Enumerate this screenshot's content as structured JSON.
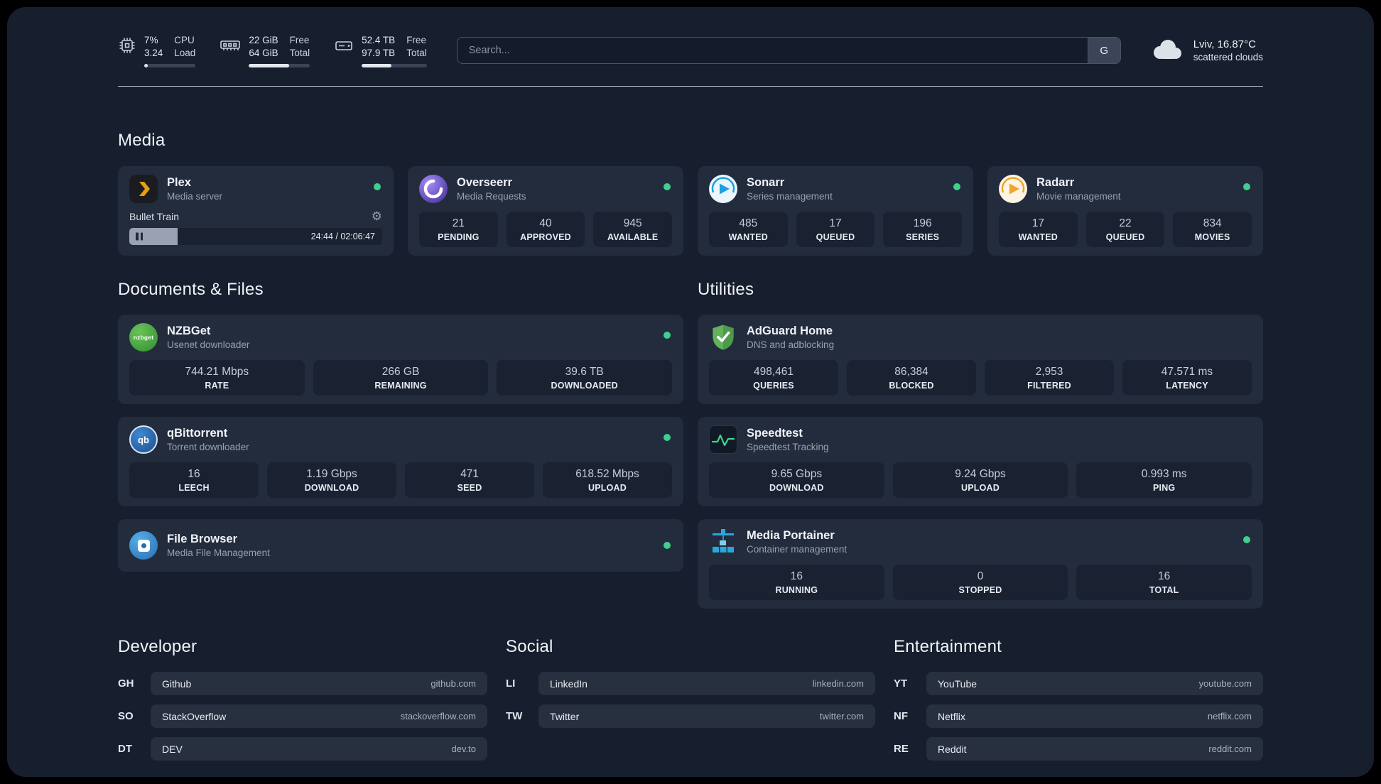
{
  "header": {
    "cpu": {
      "value1": "7%",
      "value2": "3.24",
      "label1": "CPU",
      "label2": "Load",
      "bar_percent": 7
    },
    "memory": {
      "value1": "22 GiB",
      "value2": "64 GiB",
      "label1": "Free",
      "label2": "Total",
      "bar_percent": 66
    },
    "disk": {
      "value1": "52.4 TB",
      "value2": "97.9 TB",
      "label1": "Free",
      "label2": "Total",
      "bar_percent": 46
    },
    "search": {
      "placeholder": "Search...",
      "engine_button": "G"
    },
    "weather": {
      "location": "Lviv, 16.87°C",
      "condition": "scattered clouds"
    }
  },
  "sections": {
    "media": {
      "title": "Media",
      "plex": {
        "name": "Plex",
        "desc": "Media server",
        "now_playing": "Bullet Train",
        "time": "24:44 / 02:06:47",
        "progress_percent": 19
      },
      "overseerr": {
        "name": "Overseerr",
        "desc": "Media Requests",
        "stats": [
          {
            "value": "21",
            "label": "PENDING"
          },
          {
            "value": "40",
            "label": "APPROVED"
          },
          {
            "value": "945",
            "label": "AVAILABLE"
          }
        ]
      },
      "sonarr": {
        "name": "Sonarr",
        "desc": "Series management",
        "stats": [
          {
            "value": "485",
            "label": "WANTED"
          },
          {
            "value": "17",
            "label": "QUEUED"
          },
          {
            "value": "196",
            "label": "SERIES"
          }
        ]
      },
      "radarr": {
        "name": "Radarr",
        "desc": "Movie management",
        "stats": [
          {
            "value": "17",
            "label": "WANTED"
          },
          {
            "value": "22",
            "label": "QUEUED"
          },
          {
            "value": "834",
            "label": "MOVIES"
          }
        ]
      }
    },
    "documents": {
      "title": "Documents & Files",
      "nzbget": {
        "name": "NZBGet",
        "desc": "Usenet downloader",
        "icon_text": "nzbget",
        "stats": [
          {
            "value": "744.21 Mbps",
            "label": "RATE"
          },
          {
            "value": "266 GB",
            "label": "REMAINING"
          },
          {
            "value": "39.6 TB",
            "label": "DOWNLOADED"
          }
        ]
      },
      "qbittorrent": {
        "name": "qBittorrent",
        "desc": "Torrent downloader",
        "icon_text": "qb",
        "stats": [
          {
            "value": "16",
            "label": "LEECH"
          },
          {
            "value": "1.19 Gbps",
            "label": "DOWNLOAD"
          },
          {
            "value": "471",
            "label": "SEED"
          },
          {
            "value": "618.52 Mbps",
            "label": "UPLOAD"
          }
        ]
      },
      "filebrowser": {
        "name": "File Browser",
        "desc": "Media File Management"
      }
    },
    "utilities": {
      "title": "Utilities",
      "adguard": {
        "name": "AdGuard Home",
        "desc": "DNS and adblocking",
        "stats": [
          {
            "value": "498,461",
            "label": "QUERIES"
          },
          {
            "value": "86,384",
            "label": "BLOCKED"
          },
          {
            "value": "2,953",
            "label": "FILTERED"
          },
          {
            "value": "47.571 ms",
            "label": "LATENCY"
          }
        ]
      },
      "speedtest": {
        "name": "Speedtest",
        "desc": "Speedtest Tracking",
        "stats": [
          {
            "value": "9.65 Gbps",
            "label": "DOWNLOAD"
          },
          {
            "value": "9.24 Gbps",
            "label": "UPLOAD"
          },
          {
            "value": "0.993 ms",
            "label": "PING"
          }
        ]
      },
      "portainer": {
        "name": "Media Portainer",
        "desc": "Container management",
        "stats": [
          {
            "value": "16",
            "label": "RUNNING"
          },
          {
            "value": "0",
            "label": "STOPPED"
          },
          {
            "value": "16",
            "label": "TOTAL"
          }
        ]
      }
    }
  },
  "bookmarks": {
    "developer": {
      "title": "Developer",
      "items": [
        {
          "abbr": "GH",
          "name": "Github",
          "url": "github.com"
        },
        {
          "abbr": "SO",
          "name": "StackOverflow",
          "url": "stackoverflow.com"
        },
        {
          "abbr": "DT",
          "name": "DEV",
          "url": "dev.to"
        }
      ]
    },
    "social": {
      "title": "Social",
      "items": [
        {
          "abbr": "LI",
          "name": "LinkedIn",
          "url": "linkedin.com"
        },
        {
          "abbr": "TW",
          "name": "Twitter",
          "url": "twitter.com"
        }
      ]
    },
    "entertainment": {
      "title": "Entertainment",
      "items": [
        {
          "abbr": "YT",
          "name": "YouTube",
          "url": "youtube.com"
        },
        {
          "abbr": "NF",
          "name": "Netflix",
          "url": "netflix.com"
        },
        {
          "abbr": "RE",
          "name": "Reddit",
          "url": "reddit.com"
        }
      ]
    }
  },
  "colors": {
    "background": "#171e2e",
    "card": "#232c3d",
    "stat_tile": "#1a2232",
    "status_online": "#3ed08d",
    "plex_accent": "#e5a00d"
  }
}
